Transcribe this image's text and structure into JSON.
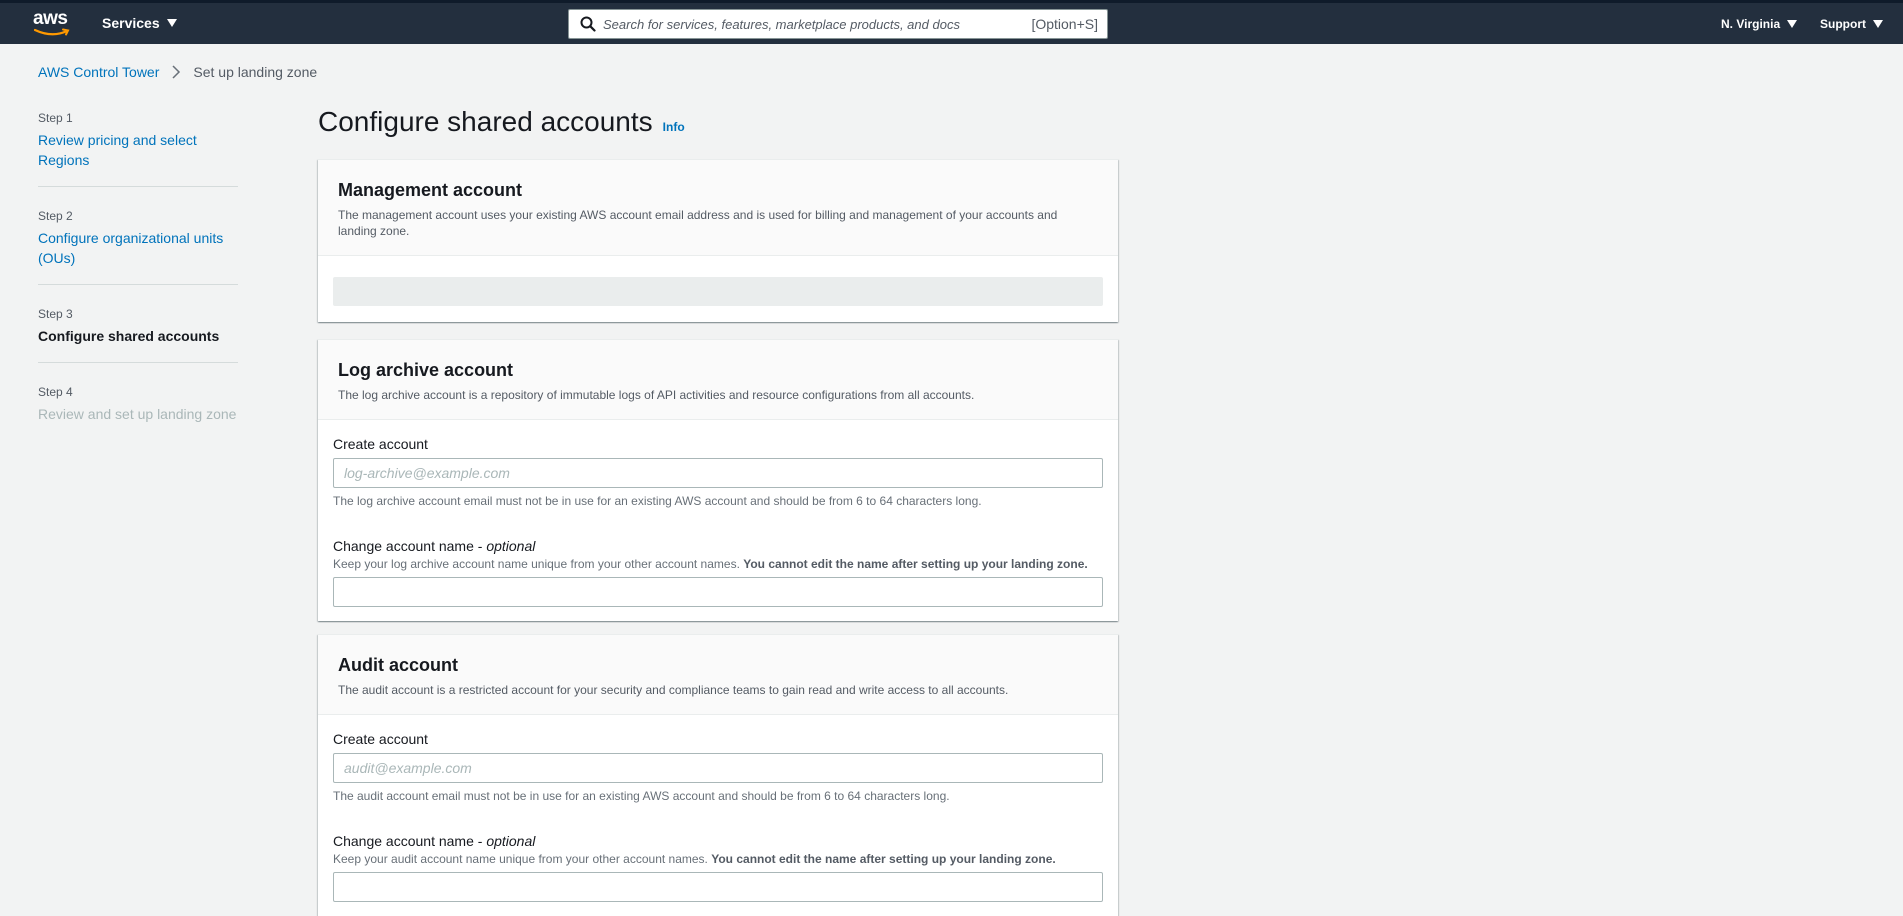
{
  "topbar": {
    "logo": "aws",
    "services_label": "Services",
    "search_placeholder": "Search for services, features, marketplace products, and docs",
    "search_shortcut": "[Option+S]",
    "region_label": "N. Virginia",
    "support_label": "Support"
  },
  "breadcrumb": {
    "root": "AWS Control Tower",
    "current": "Set up landing zone"
  },
  "steps": [
    {
      "num": "Step 1",
      "label": "Review pricing and select Regions"
    },
    {
      "num": "Step 2",
      "label": "Configure organizational units (OUs)"
    },
    {
      "num": "Step 3",
      "label": "Configure shared accounts"
    },
    {
      "num": "Step 4",
      "label": "Review and set up landing zone"
    }
  ],
  "page": {
    "title": "Configure shared accounts",
    "info": "Info"
  },
  "management": {
    "title": "Management account",
    "description": "The management account uses your existing AWS account email address and is used for billing and management of your accounts and landing zone."
  },
  "log_archive": {
    "title": "Log archive account",
    "description": "The log archive account is a repository of immutable logs of API activities and resource configurations from all accounts.",
    "create_label": "Create account",
    "email_placeholder": "log-archive@example.com",
    "email_hint": "The log archive account email must not be in use for an existing AWS account and should be from 6 to 64 characters long.",
    "name_label": "Change account name - ",
    "name_optional": "optional",
    "name_desc": "Keep your log archive account name unique from your other account names. ",
    "name_desc_bold": "You cannot edit the name after setting up your landing zone.",
    "name_value": ""
  },
  "audit": {
    "title": "Audit account",
    "description": "The audit account is a restricted account for your security and compliance teams to gain read and write access to all accounts.",
    "create_label": "Create account",
    "email_placeholder": "audit@example.com",
    "email_hint": "The audit account email must not be in use for an existing AWS account and should be from 6 to 64 characters long.",
    "name_label": "Change account name - ",
    "name_optional": "optional",
    "name_desc": "Keep your audit account name unique from your other account names. ",
    "name_desc_bold": "You cannot edit the name after setting up your landing zone.",
    "name_value": ""
  },
  "colors": {
    "header_bg": "#232f3e",
    "link": "#0073bb",
    "page_bg": "#f2f3f3",
    "smile": "#ff9900"
  }
}
